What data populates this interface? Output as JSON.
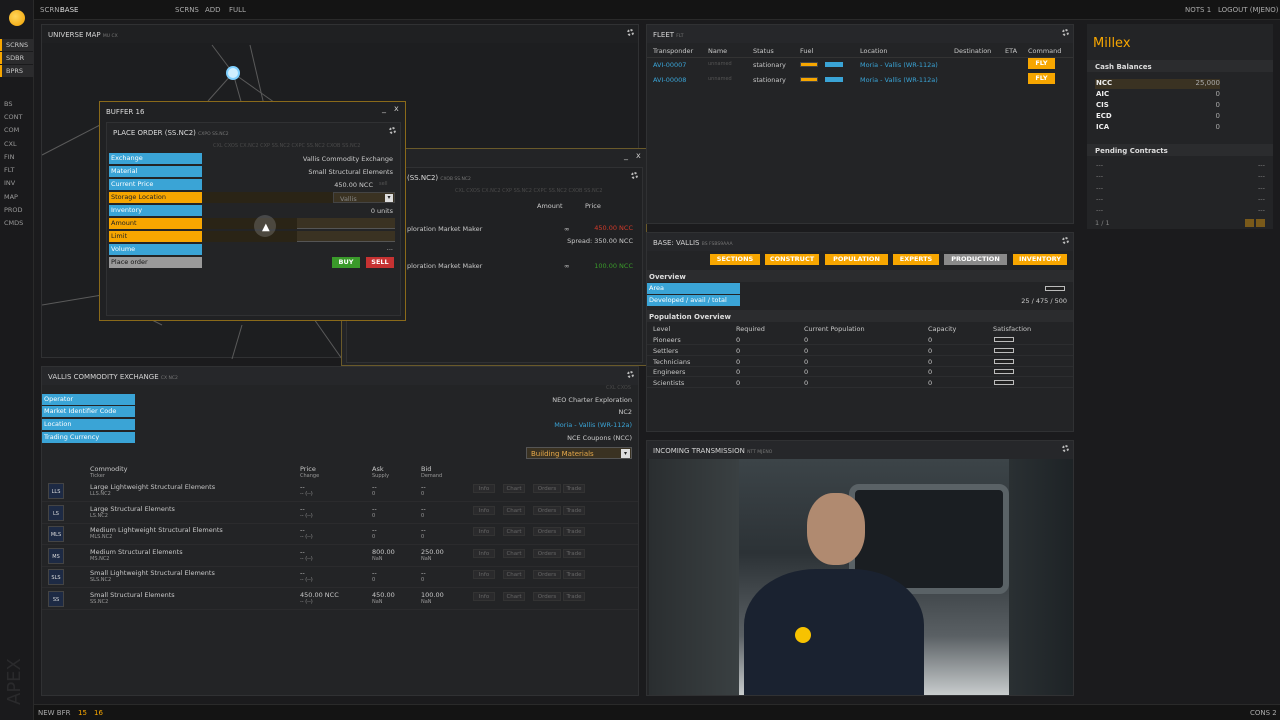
{
  "topbar": {
    "scrn_label": "SCRN:",
    "scrn_value": "BASE",
    "scrns": "SCRNS",
    "add": "ADD",
    "full": "FULL",
    "nots": "NOTS 1",
    "logout": "LOGOUT (MJENO)"
  },
  "botbar": {
    "new_bfr": "NEW BFR",
    "n1": "15",
    "n2": "16",
    "cons": "CONS 2"
  },
  "sidebar": {
    "items": [
      "SCRNS",
      "SDBR",
      "BPRS",
      "BS",
      "CONT",
      "COM",
      "CXL",
      "FIN",
      "FLT",
      "INV",
      "MAP",
      "PROD",
      "CMDS"
    ],
    "watermark": "APEX"
  },
  "universe_map": {
    "title": "UNIVERSE MAP",
    "sub": "MU CX"
  },
  "buffer": {
    "title": "BUFFER 16",
    "close": "x",
    "minimize": "_",
    "place_order": {
      "title": "PLACE ORDER (SS.NC2)",
      "sub": "CXPO SS.NC2",
      "tabs": "CXL CXOS CX.NC2 CXP SS.NC2 CXPC SS.NC2 CXOB SS.NC2",
      "fields": [
        {
          "label": "Exchange",
          "value": "Vallis Commodity Exchange"
        },
        {
          "label": "Material",
          "value": "Small Structural Elements"
        },
        {
          "label": "Current Price",
          "value": "450.00 NCC"
        },
        {
          "label": "Storage Location",
          "value": "Vallis"
        },
        {
          "label": "Inventory",
          "value": "0 units"
        },
        {
          "label": "Amount",
          "value": ""
        },
        {
          "label": "Limit",
          "value": ""
        },
        {
          "label": "Volume",
          "value": "..."
        },
        {
          "label": "Place order",
          "value": ""
        }
      ],
      "buy": "BUY",
      "sell": "SELL",
      "sell_hint": "sell"
    }
  },
  "orderbook": {
    "title": "(SS.NC2)",
    "sub": "CXOB SS.NC2",
    "close": "x",
    "minimize": "_",
    "tabs": "CXL CXOS CX.NC2 CXP SS.NC2 CXPC SS.NC2 CXOB SS.NC2",
    "col_amount": "Amount",
    "col_price": "Price",
    "ask_name": "ploration Market Maker",
    "ask_amount": "∞",
    "ask_price": "450.00 NCC",
    "spread": "Spread: 350.00 NCC",
    "bid_name": "ploration Market Maker",
    "bid_amount": "∞",
    "bid_price": "100.00 NCC"
  },
  "exchange": {
    "title": "VALLIS COMMODITY EXCHANGE",
    "sub": "CX NC2",
    "tabs": "CXL CXOS",
    "info": [
      {
        "label": "Operator",
        "value": "NEO Charter Exploration"
      },
      {
        "label": "Market Identifier Code",
        "value": "NC2"
      },
      {
        "label": "Location",
        "value": "Moria - Vallis (WR-112a)"
      },
      {
        "label": "Trading Currency",
        "value": "NCE Coupons (NCC)"
      }
    ],
    "category": "Building Materials",
    "headers": {
      "commodity": "Commodity",
      "ticker": "Ticker",
      "price": "Price",
      "change": "Change",
      "ask": "Ask",
      "supply": "Supply",
      "bid": "Bid",
      "demand": "Demand"
    },
    "rows": [
      {
        "tick": "LLS",
        "name": "Large Lightweight Structural Elements",
        "ticker": "LLS.NC2",
        "price": "--",
        "change": "-- (--)",
        "ask": "--",
        "supply": "0",
        "bid": "--",
        "demand": "0"
      },
      {
        "tick": "LS",
        "name": "Large Structural Elements",
        "ticker": "LS.NC2",
        "price": "--",
        "change": "-- (--)",
        "ask": "--",
        "supply": "0",
        "bid": "--",
        "demand": "0"
      },
      {
        "tick": "MLS",
        "name": "Medium Lightweight Structural Elements",
        "ticker": "MLS.NC2",
        "price": "--",
        "change": "-- (--)",
        "ask": "--",
        "supply": "0",
        "bid": "--",
        "demand": "0"
      },
      {
        "tick": "MS",
        "name": "Medium Structural Elements",
        "ticker": "MS.NC2",
        "price": "--",
        "change": "-- (--)",
        "ask": "800.00",
        "supply": "NaN",
        "bid": "250.00",
        "demand": "NaN"
      },
      {
        "tick": "SLS",
        "name": "Small Lightweight Structural Elements",
        "ticker": "SLS.NC2",
        "price": "--",
        "change": "-- (--)",
        "ask": "--",
        "supply": "0",
        "bid": "--",
        "demand": "0"
      },
      {
        "tick": "SS",
        "name": "Small Structural Elements",
        "ticker": "SS.NC2",
        "price": "450.00 NCC",
        "change": "-- (--)",
        "ask": "450.00",
        "supply": "NaN",
        "bid": "100.00",
        "demand": "NaN"
      }
    ],
    "actions": [
      "Info",
      "Chart",
      "Orders",
      "Trade"
    ]
  },
  "fleet": {
    "title": "FLEET",
    "sub": "FLT",
    "headers": [
      "Transponder",
      "Name",
      "Status",
      "Fuel",
      "Location",
      "Destination",
      "ETA",
      "Command"
    ],
    "rows": [
      {
        "id": "AVI-00007",
        "name": "unnamed",
        "status": "stationary",
        "location": "Moria - Vallis (WR-112a)",
        "cmd": "FLY"
      },
      {
        "id": "AVI-00008",
        "name": "unnamed",
        "status": "stationary",
        "location": "Moria - Vallis (WR-112a)",
        "cmd": "FLY"
      }
    ]
  },
  "company": {
    "name": "Millex",
    "cash_title": "Cash Balances",
    "cash": [
      {
        "cur": "NCC",
        "amt": "25,000"
      },
      {
        "cur": "AIC",
        "amt": "0"
      },
      {
        "cur": "CIS",
        "amt": "0"
      },
      {
        "cur": "ECD",
        "amt": "0"
      },
      {
        "cur": "ICA",
        "amt": "0"
      }
    ],
    "pending_title": "Pending Contracts",
    "pending": [
      "---",
      "---",
      "---",
      "---",
      "---"
    ],
    "pending_right": "---",
    "pager": "1 / 1"
  },
  "base": {
    "title": "BASE: VALLIS",
    "sub": "BS FSBS9AAA",
    "tabs": [
      "SECTIONS",
      "CONSTRUCT",
      "POPULATION",
      "EXPERTS",
      "PRODUCTION",
      "INVENTORY"
    ],
    "overview": "Overview",
    "area": "Area",
    "developed": "Developed / avail / total",
    "developed_value": "25 / 475 / 500",
    "pop_title": "Population Overview",
    "pop_headers": [
      "Level",
      "Required",
      "Current Population",
      "Capacity",
      "Satisfaction"
    ],
    "pop": [
      {
        "level": "Pioneers",
        "req": "0",
        "cur": "0",
        "cap": "0"
      },
      {
        "level": "Settlers",
        "req": "0",
        "cur": "0",
        "cap": "0"
      },
      {
        "level": "Technicians",
        "req": "0",
        "cur": "0",
        "cap": "0"
      },
      {
        "level": "Engineers",
        "req": "0",
        "cur": "0",
        "cap": "0"
      },
      {
        "level": "Scientists",
        "req": "0",
        "cur": "0",
        "cap": "0"
      }
    ]
  },
  "transmission": {
    "title": "INCOMING TRANSMISSION",
    "sub": "NTT MJENO"
  }
}
